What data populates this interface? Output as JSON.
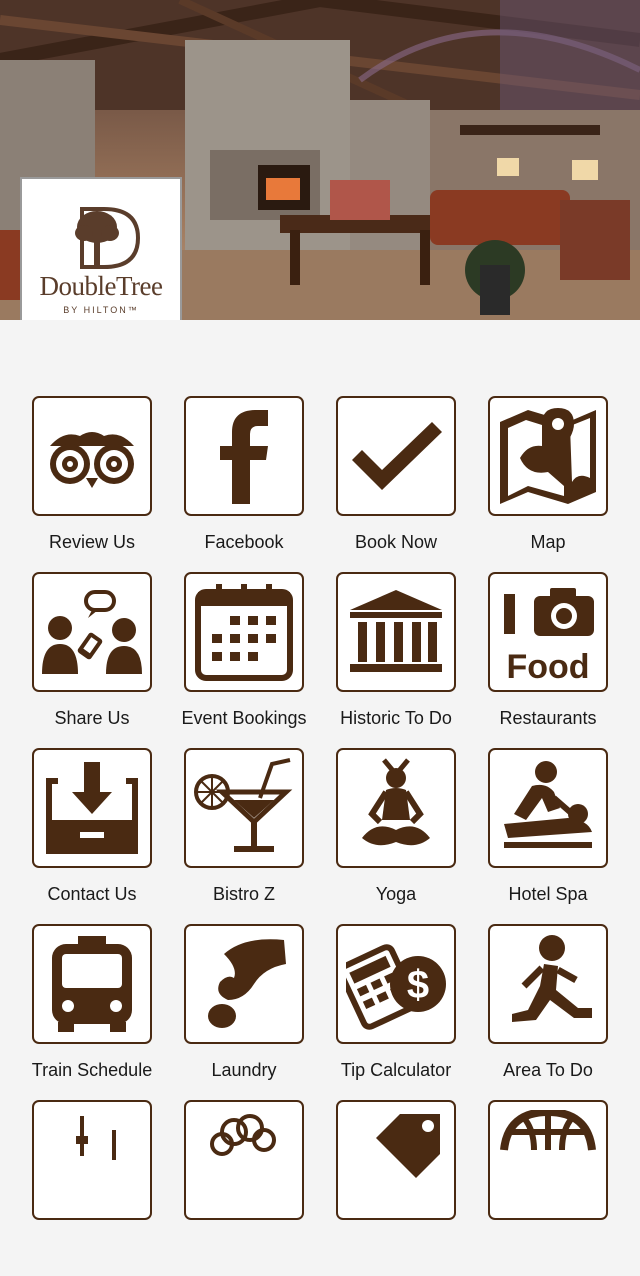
{
  "hero": {
    "photo": "hotel-lobby-photo",
    "logo": {
      "name": "DoubleTree",
      "sub": "BY HILTON™"
    }
  },
  "colors": {
    "icon": "#4a2a12",
    "tile_border": "#4a2a12",
    "background": "#f4f4f4"
  },
  "tiles": [
    {
      "label": "Review Us",
      "icon": "owl-eyes-icon"
    },
    {
      "label": "Facebook",
      "icon": "facebook-icon"
    },
    {
      "label": "Book Now",
      "icon": "checkmark-icon"
    },
    {
      "label": "Map",
      "icon": "map-pin-icon"
    },
    {
      "label": "Share Us",
      "icon": "share-people-icon"
    },
    {
      "label": "Event Bookings",
      "icon": "calendar-icon"
    },
    {
      "label": "Historic To Do",
      "icon": "museum-icon"
    },
    {
      "label": "Restaurants",
      "icon": "camera-food-icon"
    },
    {
      "label": "Contact Us",
      "icon": "inbox-icon"
    },
    {
      "label": "Bistro Z",
      "icon": "cocktail-icon"
    },
    {
      "label": "Yoga",
      "icon": "yoga-icon"
    },
    {
      "label": "Hotel Spa",
      "icon": "massage-icon"
    },
    {
      "label": "Train Schedule",
      "icon": "bus-icon"
    },
    {
      "label": "Laundry",
      "icon": "hand-coin-icon"
    },
    {
      "label": "Tip Calculator",
      "icon": "calculator-dollar-icon"
    },
    {
      "label": "Area To Do",
      "icon": "runner-icon"
    },
    {
      "label": "",
      "icon": "tower-icon"
    },
    {
      "label": "",
      "icon": "cloud-icon"
    },
    {
      "label": "",
      "icon": "tag-icon"
    },
    {
      "label": "",
      "icon": "globe-icon"
    }
  ]
}
